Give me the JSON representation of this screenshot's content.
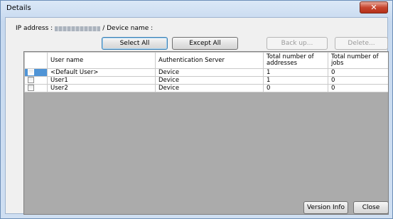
{
  "window": {
    "title": "Details",
    "close_glyph": "✕"
  },
  "info": {
    "ip_label": "IP address :",
    "device_label": "/ Device name :"
  },
  "toolbar": {
    "select_all": "Select All",
    "except_all": "Except All",
    "back_up": "Back up...",
    "delete": "Delete..."
  },
  "table": {
    "headers": [
      "User name",
      "Authentication Server",
      "Total number of addresses",
      "Total number of jobs"
    ],
    "rows": [
      {
        "user": "<Default User>",
        "server": "Device",
        "addresses": "1",
        "jobs": "0",
        "selected": true
      },
      {
        "user": "User1",
        "server": "Device",
        "addresses": "1",
        "jobs": "0",
        "selected": false
      },
      {
        "user": "User2",
        "server": "Device",
        "addresses": "0",
        "jobs": "0",
        "selected": false
      }
    ]
  },
  "footer": {
    "version_info": "Version Info",
    "close": "Close"
  }
}
